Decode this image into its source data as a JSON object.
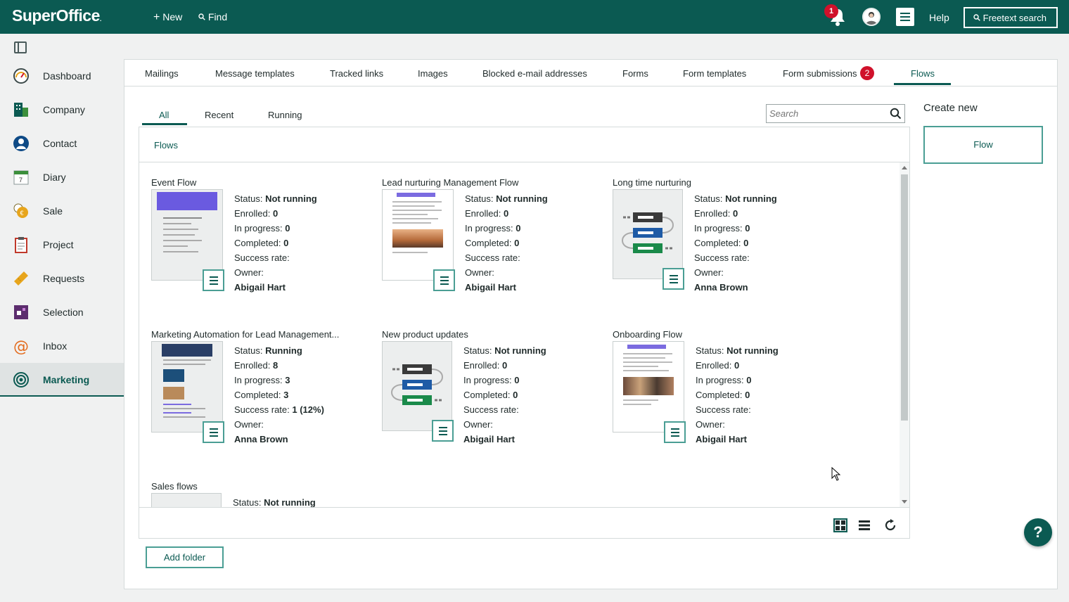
{
  "app": {
    "logo": "SuperOffice",
    "logo_suffix": "."
  },
  "topbar": {
    "new_label": "New",
    "find_label": "Find",
    "notifications_count": "1",
    "help_label": "Help",
    "freetext_label": "Freetext search"
  },
  "sidebar": {
    "items": [
      {
        "label": "Dashboard",
        "icon": "gauge-icon"
      },
      {
        "label": "Company",
        "icon": "building-icon"
      },
      {
        "label": "Contact",
        "icon": "person-icon"
      },
      {
        "label": "Diary",
        "icon": "calendar-icon"
      },
      {
        "label": "Sale",
        "icon": "coins-icon"
      },
      {
        "label": "Project",
        "icon": "clipboard-icon"
      },
      {
        "label": "Requests",
        "icon": "ticket-icon"
      },
      {
        "label": "Selection",
        "icon": "selection-icon"
      },
      {
        "label": "Inbox",
        "icon": "at-icon"
      },
      {
        "label": "Marketing",
        "icon": "target-icon",
        "active": true
      }
    ]
  },
  "tabs": [
    "Mailings",
    "Message templates",
    "Tracked links",
    "Images",
    "Blocked e-mail addresses",
    "Forms",
    "Form templates",
    "Form submissions",
    "Flows"
  ],
  "form_submissions_badge": "2",
  "subtabs": [
    "All",
    "Recent",
    "Running"
  ],
  "search": {
    "placeholder": "Search"
  },
  "breadcrumb": "Flows",
  "labels": {
    "status": "Status:",
    "enrolled": "Enrolled:",
    "in_progress": "In progress:",
    "completed": "Completed:",
    "success_rate": "Success rate:",
    "owner": "Owner:"
  },
  "flows": [
    {
      "name": "Event Flow",
      "status": "Not running",
      "enrolled": "0",
      "in_progress": "0",
      "completed": "0",
      "success_rate": "",
      "owner": "Abigail Hart",
      "thumb": "email-template"
    },
    {
      "name": "Lead nurturing Management Flow",
      "status": "Not running",
      "enrolled": "0",
      "in_progress": "0",
      "completed": "0",
      "success_rate": "",
      "owner": "Abigail Hart",
      "thumb": "email-sunset"
    },
    {
      "name": "Long time nurturing",
      "status": "Not running",
      "enrolled": "0",
      "in_progress": "0",
      "completed": "0",
      "success_rate": "",
      "owner": "Anna Brown",
      "thumb": "flow-diagram"
    },
    {
      "name": "Marketing Automation for Lead Management...",
      "status": "Running",
      "enrolled": "8",
      "in_progress": "3",
      "completed": "3",
      "success_rate": "1 (12%)",
      "owner": "Anna Brown",
      "thumb": "email-dark"
    },
    {
      "name": "New product updates",
      "status": "Not running",
      "enrolled": "0",
      "in_progress": "0",
      "completed": "0",
      "success_rate": "",
      "owner": "Abigail Hart",
      "thumb": "flow-diagram"
    },
    {
      "name": "Onboarding Flow",
      "status": "Not running",
      "enrolled": "0",
      "in_progress": "0",
      "completed": "0",
      "success_rate": "",
      "owner": "Abigail Hart",
      "thumb": "email-team"
    },
    {
      "name": "Sales flows",
      "status": "Not running",
      "thumb": "blank"
    }
  ],
  "add_folder_label": "Add folder",
  "create_new": {
    "title": "Create new",
    "flow_label": "Flow"
  },
  "help_fab": "?",
  "colors": {
    "brand": "#0b5a52",
    "accent": "#4a9e94",
    "badge": "#d0112b"
  }
}
